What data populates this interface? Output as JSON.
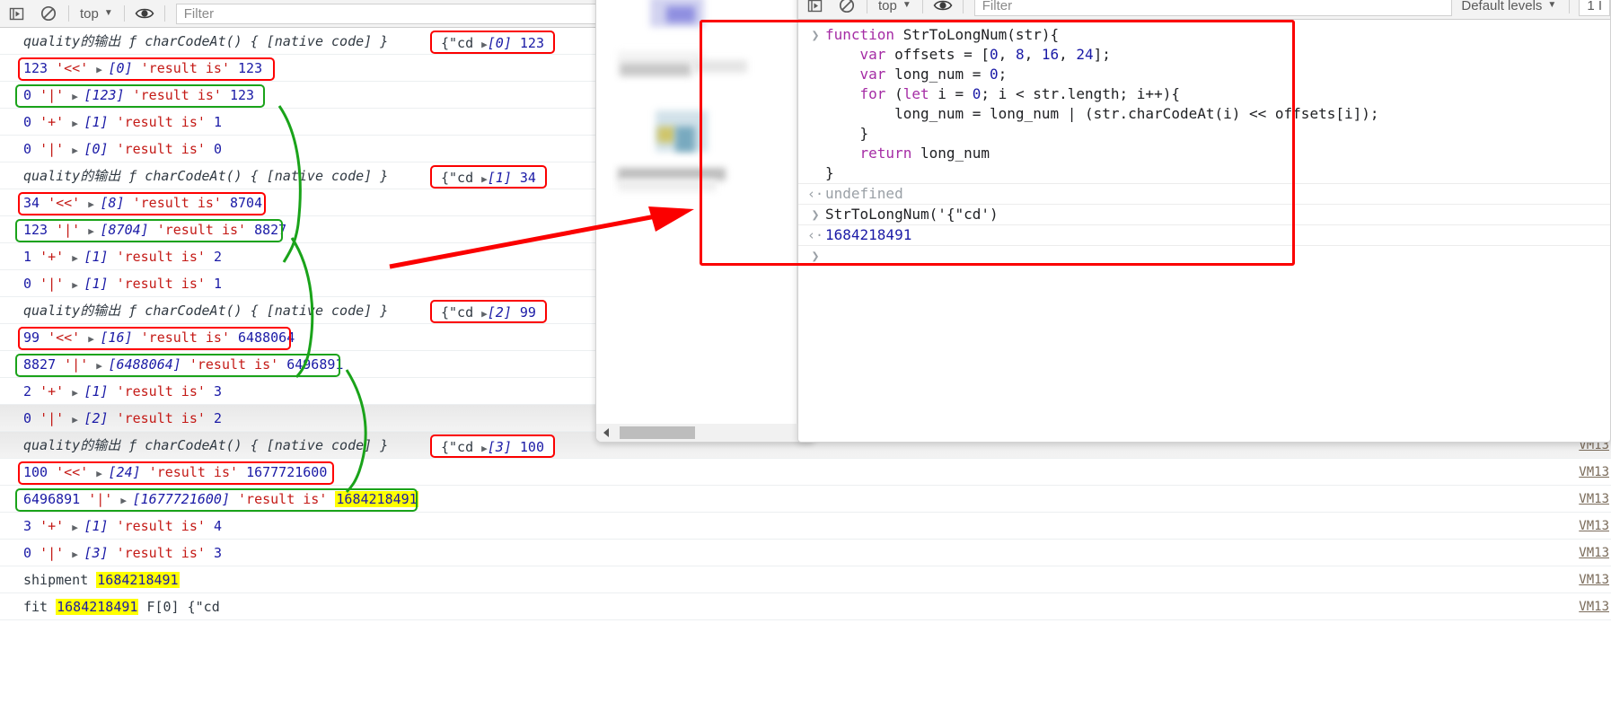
{
  "left_toolbar": {
    "execute_icon": "execute-step-icon",
    "clear_icon": "clear-console-icon",
    "context": "top",
    "caret": "▼",
    "eye_icon": "live-expression-icon",
    "filter_placeholder": "Filter"
  },
  "right_toolbar": {
    "execute_icon": "execute-step-icon",
    "clear_icon": "clear-console-icon",
    "context": "top",
    "caret": "▼",
    "eye_icon": "live-expression-icon",
    "filter_placeholder": "Filter",
    "levels_label": "Default levels",
    "issue_count": "1 I"
  },
  "log": {
    "vm_link": "VM13",
    "rows": [
      {
        "id": "r0",
        "kind": "native",
        "text": "quality的输出 ƒ charCodeAt() { [native code] }",
        "side": {
          "text": "{\"cd",
          "index": "[0]",
          "value": "123"
        },
        "box": "none"
      },
      {
        "id": "r1",
        "kind": "op",
        "a": "123",
        "op": "'<<'",
        "arg": "[0]",
        "mid": "'result is'",
        "res": "123",
        "box": "red"
      },
      {
        "id": "r2",
        "kind": "op",
        "a": "0",
        "op": "'|'",
        "arg": "[123]",
        "mid": "'result is'",
        "res": "123",
        "box": "green"
      },
      {
        "id": "r3",
        "kind": "op",
        "a": "0",
        "op": "'+'",
        "arg": "[1]",
        "mid": "'result is'",
        "res": "1",
        "box": "none"
      },
      {
        "id": "r4",
        "kind": "op",
        "a": "0",
        "op": "'|'",
        "arg": "[0]",
        "mid": "'result is'",
        "res": "0",
        "box": "none"
      },
      {
        "id": "r5",
        "kind": "native",
        "text": "quality的输出 ƒ charCodeAt() { [native code] }",
        "side": {
          "text": "{\"cd",
          "index": "[1]",
          "value": "34"
        },
        "box": "none"
      },
      {
        "id": "r6",
        "kind": "op",
        "a": "34",
        "op": "'<<'",
        "arg": "[8]",
        "mid": "'result is'",
        "res": "8704",
        "box": "red"
      },
      {
        "id": "r7",
        "kind": "op",
        "a": "123",
        "op": "'|'",
        "arg": "[8704]",
        "mid": "'result is'",
        "res": "8827",
        "box": "green"
      },
      {
        "id": "r8",
        "kind": "op",
        "a": "1",
        "op": "'+'",
        "arg": "[1]",
        "mid": "'result is'",
        "res": "2",
        "box": "none"
      },
      {
        "id": "r9",
        "kind": "op",
        "a": "0",
        "op": "'|'",
        "arg": "[1]",
        "mid": "'result is'",
        "res": "1",
        "box": "none"
      },
      {
        "id": "r10",
        "kind": "native",
        "text": "quality的输出 ƒ charCodeAt() { [native code] }",
        "side": {
          "text": "{\"cd",
          "index": "[2]",
          "value": "99"
        },
        "box": "none"
      },
      {
        "id": "r11",
        "kind": "op",
        "a": "99",
        "op": "'<<'",
        "arg": "[16]",
        "mid": "'result is'",
        "res": "6488064",
        "box": "red"
      },
      {
        "id": "r12",
        "kind": "op",
        "a": "8827",
        "op": "'|'",
        "arg": "[6488064]",
        "mid": "'result is'",
        "res": "6496891",
        "box": "green"
      },
      {
        "id": "r13",
        "kind": "op",
        "a": "2",
        "op": "'+'",
        "arg": "[1]",
        "mid": "'result is'",
        "res": "3",
        "box": "none"
      },
      {
        "id": "r14",
        "kind": "op",
        "a": "0",
        "op": "'|'",
        "arg": "[2]",
        "mid": "'result is'",
        "res": "2",
        "box": "none"
      },
      {
        "id": "r15",
        "kind": "native",
        "text": "quality的输出 ƒ charCodeAt() { [native code] }",
        "side": {
          "text": "{\"cd",
          "index": "[3]",
          "value": "100"
        },
        "box": "none"
      },
      {
        "id": "r16",
        "kind": "op",
        "a": "100",
        "op": "'<<'",
        "arg": "[24]",
        "mid": "'result is'",
        "res": "1677721600",
        "box": "red"
      },
      {
        "id": "r17",
        "kind": "op",
        "a": "6496891",
        "op": "'|'",
        "arg": "[1677721600]",
        "mid": "'result is'",
        "res": "1684218491",
        "res_highlight": true,
        "box": "green"
      },
      {
        "id": "r18",
        "kind": "op",
        "a": "3",
        "op": "'+'",
        "arg": "[1]",
        "mid": "'result is'",
        "res": "4",
        "box": "none"
      },
      {
        "id": "r19",
        "kind": "op",
        "a": "0",
        "op": "'|'",
        "arg": "[3]",
        "mid": "'result is'",
        "res": "3",
        "box": "none"
      },
      {
        "id": "r20",
        "kind": "plain",
        "label": "shipment",
        "value": "1684218491",
        "box": "none"
      },
      {
        "id": "r21",
        "kind": "plain2",
        "label": "fit",
        "value": "1684218491",
        "tail": "F[0] {\"cd",
        "box": "none"
      }
    ]
  },
  "console": {
    "lines": [
      {
        "gutter": "❯",
        "segments": [
          {
            "t": "function ",
            "c": "kw"
          },
          {
            "t": "StrToLongNum(str){",
            "c": "fn"
          }
        ]
      },
      {
        "gutter": "",
        "segments": [
          {
            "t": "    ",
            "c": "op"
          },
          {
            "t": "var ",
            "c": "kw"
          },
          {
            "t": "offsets = [",
            "c": "op"
          },
          {
            "t": "0",
            "c": "num"
          },
          {
            "t": ", ",
            "c": "op"
          },
          {
            "t": "8",
            "c": "num"
          },
          {
            "t": ", ",
            "c": "op"
          },
          {
            "t": "16",
            "c": "num"
          },
          {
            "t": ", ",
            "c": "op"
          },
          {
            "t": "24",
            "c": "num"
          },
          {
            "t": "];",
            "c": "op"
          }
        ]
      },
      {
        "gutter": "",
        "segments": [
          {
            "t": "    ",
            "c": "op"
          },
          {
            "t": "var ",
            "c": "kw"
          },
          {
            "t": "long_num = ",
            "c": "op"
          },
          {
            "t": "0",
            "c": "num"
          },
          {
            "t": ";",
            "c": "op"
          }
        ]
      },
      {
        "gutter": "",
        "segments": [
          {
            "t": "    ",
            "c": "op"
          },
          {
            "t": "for ",
            "c": "kw"
          },
          {
            "t": "(",
            "c": "op"
          },
          {
            "t": "let ",
            "c": "kw"
          },
          {
            "t": "i = ",
            "c": "op"
          },
          {
            "t": "0",
            "c": "num"
          },
          {
            "t": "; i < str.length; i++){",
            "c": "op"
          }
        ]
      },
      {
        "gutter": "",
        "segments": [
          {
            "t": "        long_num = long_num | (str.charCodeAt(i) << offsets[i]);",
            "c": "op"
          }
        ]
      },
      {
        "gutter": "",
        "segments": [
          {
            "t": "    }",
            "c": "op"
          }
        ]
      },
      {
        "gutter": "",
        "segments": [
          {
            "t": "    ",
            "c": "op"
          },
          {
            "t": "return ",
            "c": "kw"
          },
          {
            "t": "long_num",
            "c": "op"
          }
        ]
      },
      {
        "gutter": "",
        "segments": [
          {
            "t": "}",
            "c": "op"
          }
        ]
      },
      {
        "gutter": "‹·",
        "segments": [
          {
            "t": "undefined",
            "c": "und"
          }
        ],
        "sep": true
      },
      {
        "gutter": "❯",
        "segments": [
          {
            "t": "StrToLongNum('{\"cd')",
            "c": "op"
          }
        ]
      },
      {
        "gutter": "‹·",
        "segments": [
          {
            "t": "1684218491",
            "c": "res"
          }
        ],
        "sep": true
      },
      {
        "gutter": "❯",
        "segments": [
          {
            "t": "",
            "c": "op"
          }
        ]
      }
    ]
  },
  "annotations": {
    "red_box_color": "#fb0000",
    "green_box_color": "#1aa31a",
    "arrow_color": "#fb0000",
    "highlight_color": "#ffff00",
    "accent_tab_color": "#1a73e8"
  }
}
